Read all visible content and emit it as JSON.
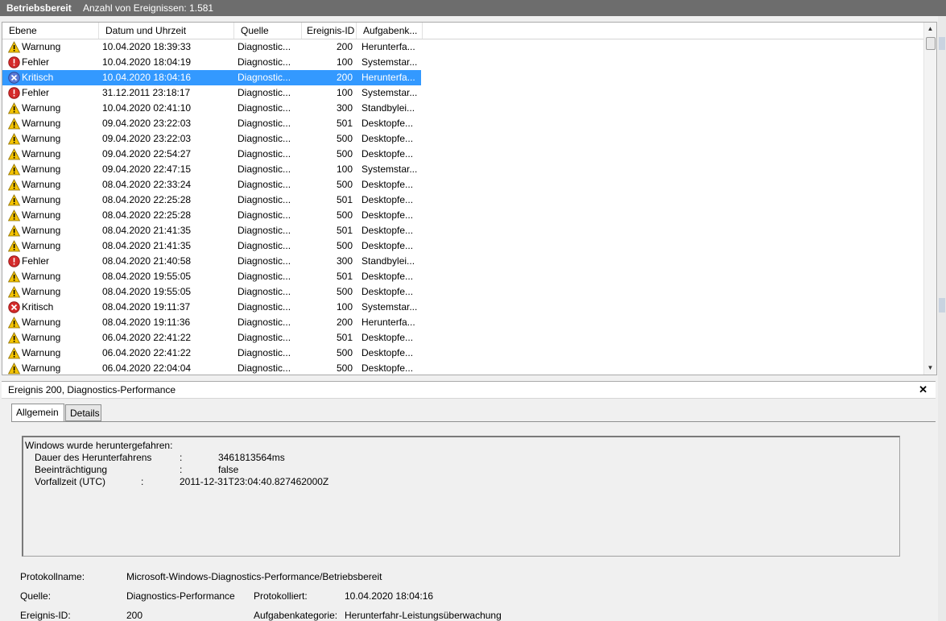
{
  "title": {
    "log_name": "Betriebsbereit",
    "event_count": "Anzahl von Ereignissen: 1.581"
  },
  "columns": [
    "Ebene",
    "Datum und Uhrzeit",
    "Quelle",
    "Ereignis-ID",
    "Aufgabenk..."
  ],
  "events": [
    {
      "level": "Warnung",
      "icon": "warning",
      "date": "10.04.2020 18:39:33",
      "source": "Diagnostic...",
      "id": "200",
      "task": "Herunterfa..."
    },
    {
      "level": "Fehler",
      "icon": "error",
      "date": "10.04.2020 18:04:19",
      "source": "Diagnostic...",
      "id": "100",
      "task": "Systemstar..."
    },
    {
      "level": "Kritisch",
      "icon": "critical",
      "date": "10.04.2020 18:04:16",
      "source": "Diagnostic...",
      "id": "200",
      "task": "Herunterfa...",
      "selected": true
    },
    {
      "level": "Fehler",
      "icon": "error",
      "date": "31.12.2011 23:18:17",
      "source": "Diagnostic...",
      "id": "100",
      "task": "Systemstar..."
    },
    {
      "level": "Warnung",
      "icon": "warning",
      "date": "10.04.2020 02:41:10",
      "source": "Diagnostic...",
      "id": "300",
      "task": "Standbylei..."
    },
    {
      "level": "Warnung",
      "icon": "warning",
      "date": "09.04.2020 23:22:03",
      "source": "Diagnostic...",
      "id": "501",
      "task": "Desktopfe..."
    },
    {
      "level": "Warnung",
      "icon": "warning",
      "date": "09.04.2020 23:22:03",
      "source": "Diagnostic...",
      "id": "500",
      "task": "Desktopfe..."
    },
    {
      "level": "Warnung",
      "icon": "warning",
      "date": "09.04.2020 22:54:27",
      "source": "Diagnostic...",
      "id": "500",
      "task": "Desktopfe..."
    },
    {
      "level": "Warnung",
      "icon": "warning",
      "date": "09.04.2020 22:47:15",
      "source": "Diagnostic...",
      "id": "100",
      "task": "Systemstar..."
    },
    {
      "level": "Warnung",
      "icon": "warning",
      "date": "08.04.2020 22:33:24",
      "source": "Diagnostic...",
      "id": "500",
      "task": "Desktopfe..."
    },
    {
      "level": "Warnung",
      "icon": "warning",
      "date": "08.04.2020 22:25:28",
      "source": "Diagnostic...",
      "id": "501",
      "task": "Desktopfe..."
    },
    {
      "level": "Warnung",
      "icon": "warning",
      "date": "08.04.2020 22:25:28",
      "source": "Diagnostic...",
      "id": "500",
      "task": "Desktopfe..."
    },
    {
      "level": "Warnung",
      "icon": "warning",
      "date": "08.04.2020 21:41:35",
      "source": "Diagnostic...",
      "id": "501",
      "task": "Desktopfe..."
    },
    {
      "level": "Warnung",
      "icon": "warning",
      "date": "08.04.2020 21:41:35",
      "source": "Diagnostic...",
      "id": "500",
      "task": "Desktopfe..."
    },
    {
      "level": "Fehler",
      "icon": "error",
      "date": "08.04.2020 21:40:58",
      "source": "Diagnostic...",
      "id": "300",
      "task": "Standbylei..."
    },
    {
      "level": "Warnung",
      "icon": "warning",
      "date": "08.04.2020 19:55:05",
      "source": "Diagnostic...",
      "id": "501",
      "task": "Desktopfe..."
    },
    {
      "level": "Warnung",
      "icon": "warning",
      "date": "08.04.2020 19:55:05",
      "source": "Diagnostic...",
      "id": "500",
      "task": "Desktopfe..."
    },
    {
      "level": "Kritisch",
      "icon": "critical",
      "date": "08.04.2020 19:11:37",
      "source": "Diagnostic...",
      "id": "100",
      "task": "Systemstar..."
    },
    {
      "level": "Warnung",
      "icon": "warning",
      "date": "08.04.2020 19:11:36",
      "source": "Diagnostic...",
      "id": "200",
      "task": "Herunterfa..."
    },
    {
      "level": "Warnung",
      "icon": "warning",
      "date": "06.04.2020 22:41:22",
      "source": "Diagnostic...",
      "id": "501",
      "task": "Desktopfe..."
    },
    {
      "level": "Warnung",
      "icon": "warning",
      "date": "06.04.2020 22:41:22",
      "source": "Diagnostic...",
      "id": "500",
      "task": "Desktopfe..."
    },
    {
      "level": "Warnung",
      "icon": "warning",
      "date": "06.04.2020 22:04:04",
      "source": "Diagnostic...",
      "id": "500",
      "task": "Desktopfe..."
    }
  ],
  "detail": {
    "header": "Ereignis 200, Diagnostics-Performance",
    "close_icon": "close-icon",
    "tabs": [
      "Allgemein",
      "Details"
    ],
    "message": {
      "line1": "Windows wurde heruntergefahren:",
      "k1": "Dauer des Herunterfahrens",
      "s1": ":",
      "v1": "3461813564ms",
      "k2": "Beeinträchtigung",
      "s2": ":",
      "v2": "false",
      "k3": "Vorfallzeit (UTC)",
      "s3": ":",
      "v3": "2011-12-31T23:04:40.827462000Z"
    },
    "props": {
      "logname_label": "Protokollname:",
      "logname_value": "Microsoft-Windows-Diagnostics-Performance/Betriebsbereit",
      "source_label": "Quelle:",
      "source_value": "Diagnostics-Performance",
      "logged_label": "Protokolliert:",
      "logged_value": "10.04.2020 18:04:16",
      "eventid_label": "Ereignis-ID:",
      "eventid_value": "200",
      "taskcat_label": "Aufgabenkategorie:",
      "taskcat_value": "Herunterfahr-Leistungsüberwachung"
    }
  },
  "colors": {
    "selection": "#3399ff",
    "warning": "#f5c400",
    "error": "#d42b2b",
    "critical_selected": "#5a7ad6"
  }
}
